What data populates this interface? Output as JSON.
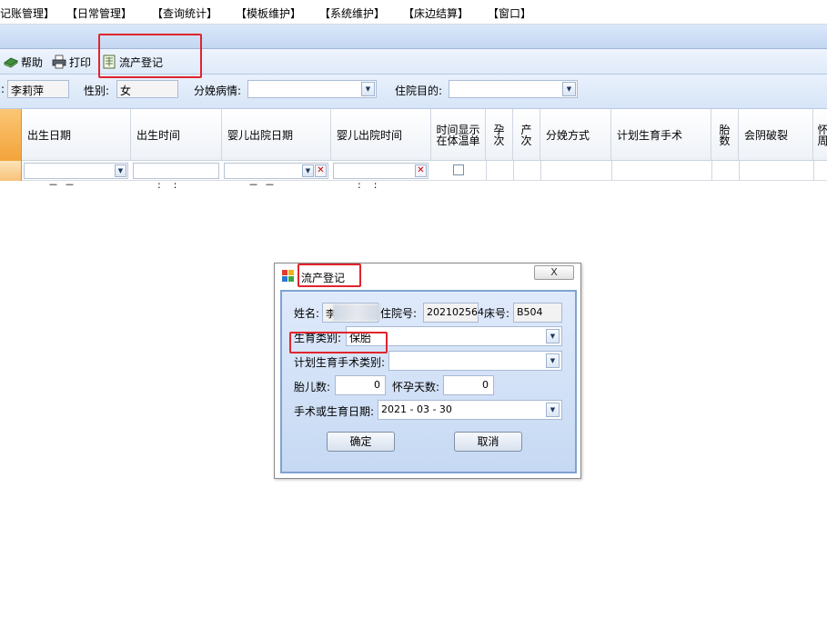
{
  "menu": {
    "items": [
      "记账管理】",
      "【日常管理】",
      "【查询统计】",
      "【模板维护】",
      "【系统维护】",
      "【床边结算】",
      "【窗口】"
    ]
  },
  "toolbar": {
    "help_label": "帮助",
    "print_label": "打印",
    "abortion_label": "流产登记"
  },
  "filter": {
    "name_label": ":",
    "name_value": "李莉萍",
    "gender_label": "性别:",
    "gender_value": "女",
    "delivery_condition_label": "分娩病情:",
    "delivery_condition_value": "",
    "admission_purpose_label": "住院目的:",
    "admission_purpose_value": ""
  },
  "grid": {
    "headers": [
      "出生日期",
      "出生时间",
      "婴儿出院日期",
      "婴儿出院时间",
      "时间显示在体温单",
      "孕次",
      "产次",
      "分娩方式",
      "计划生育手术",
      "胎数",
      "会阴破裂",
      "怀周"
    ],
    "row": {
      "birth_date": "－  －",
      "birth_time": ":    :",
      "discharge_date": "－  －",
      "discharge_time": ":    :"
    }
  },
  "dialog": {
    "title": "流产登记",
    "close_glyph": "X",
    "name_label": "姓名:",
    "name_value": "李",
    "admission_no_label": "住院号:",
    "admission_no_partial_label": "住院号:",
    "admission_no_value": "202102564",
    "bed_no_label": "床号:",
    "bed_no_value": "B504",
    "birth_type_label": "生育类别:",
    "birth_type_value": "保胎",
    "fp_surgery_type_label": "计划生育手术类别:",
    "fp_surgery_type_value": "",
    "fetus_count_label": "胎儿数:",
    "fetus_count_value": "0",
    "pregnancy_days_label": "怀孕天数:",
    "pregnancy_days_value": "0",
    "surgery_date_label": "手术或生育日期:",
    "surgery_date_value": "2021 - 03 - 30",
    "ok_label": "确定",
    "cancel_label": "取消"
  },
  "colors": {
    "highlight": "#e0242e",
    "band_blue": "#c3d7f2",
    "row_indicator": "#f3a33a"
  }
}
